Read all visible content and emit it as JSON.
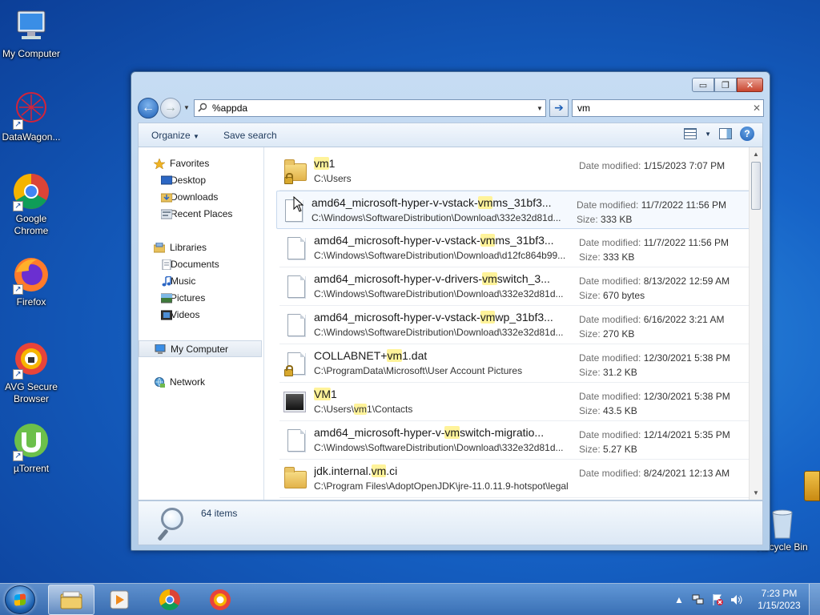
{
  "desktop": {
    "icons": [
      {
        "label": "My Computer"
      },
      {
        "label": "DataWagon..."
      },
      {
        "label": "Google Chrome"
      },
      {
        "label": "Firefox"
      },
      {
        "label": "AVG Secure Browser"
      },
      {
        "label": "µTorrent"
      },
      {
        "label": "Recycle Bin"
      }
    ]
  },
  "window": {
    "caption": {
      "minimize": "▭",
      "maximize": "❐",
      "close": "✕"
    },
    "address": {
      "value": "%appda"
    },
    "search": {
      "value": "vm"
    },
    "toolbar": {
      "organize": "Organize",
      "save_search": "Save search"
    },
    "nav": {
      "favorites": "Favorites",
      "desktop": "Desktop",
      "downloads": "Downloads",
      "recent": "Recent Places",
      "libraries": "Libraries",
      "documents": "Documents",
      "music": "Music",
      "pictures": "Pictures",
      "videos": "Videos",
      "my_computer": "My Computer",
      "network": "Network"
    },
    "labels": {
      "date_modified": "Date modified:",
      "size": "Size:"
    },
    "results": [
      {
        "pre": "",
        "hl": "vm",
        "post": "1",
        "path_pre": "C:\\Users",
        "path_hl": "",
        "path_post": "",
        "date": "1/15/2023 7:07 PM",
        "size": ""
      },
      {
        "pre": "amd64_microsoft-hyper-v-vstack-",
        "hl": "vm",
        "post": "ms_31bf3...",
        "path_pre": "C:\\Windows\\SoftwareDistribution\\Download\\332e32d81d...",
        "path_hl": "",
        "path_post": "",
        "date": "11/7/2022 11:56 PM",
        "size": "333 KB"
      },
      {
        "pre": "amd64_microsoft-hyper-v-vstack-",
        "hl": "vm",
        "post": "ms_31bf3...",
        "path_pre": "C:\\Windows\\SoftwareDistribution\\Download\\d12fc864b99...",
        "path_hl": "",
        "path_post": "",
        "date": "11/7/2022 11:56 PM",
        "size": "333 KB"
      },
      {
        "pre": "amd64_microsoft-hyper-v-drivers-",
        "hl": "vm",
        "post": "switch_3...",
        "path_pre": "C:\\Windows\\SoftwareDistribution\\Download\\332e32d81d...",
        "path_hl": "",
        "path_post": "",
        "date": "8/13/2022 12:59 AM",
        "size": "670 bytes"
      },
      {
        "pre": "amd64_microsoft-hyper-v-vstack-",
        "hl": "vm",
        "post": "wp_31bf3...",
        "path_pre": "C:\\Windows\\SoftwareDistribution\\Download\\332e32d81d...",
        "path_hl": "",
        "path_post": "",
        "date": "6/16/2022 3:21 AM",
        "size": "270 KB"
      },
      {
        "pre": "COLLABNET+",
        "hl": "vm",
        "post": "1.dat",
        "path_pre": "C:\\ProgramData\\Microsoft\\User Account Pictures",
        "path_hl": "",
        "path_post": "",
        "date": "12/30/2021 5:38 PM",
        "size": "31.2 KB"
      },
      {
        "pre": "",
        "hl": "VM",
        "post": "1",
        "path_pre": "C:\\Users\\",
        "path_hl": "vm",
        "path_post": "1\\Contacts",
        "date": "12/30/2021 5:38 PM",
        "size": "43.5 KB"
      },
      {
        "pre": "amd64_microsoft-hyper-v-",
        "hl": "vm",
        "post": "switch-migratio...",
        "path_pre": "C:\\Windows\\SoftwareDistribution\\Download\\332e32d81d...",
        "path_hl": "",
        "path_post": "",
        "date": "12/14/2021 5:35 PM",
        "size": "5.27 KB"
      },
      {
        "pre": "jdk.internal.",
        "hl": "vm",
        "post": ".ci",
        "path_pre": "C:\\Program Files\\AdoptOpenJDK\\jre-11.0.11.9-hotspot\\legal",
        "path_hl": "",
        "path_post": "",
        "date": "8/24/2021 12:13 AM",
        "size": ""
      }
    ],
    "status": {
      "count": "64 items"
    }
  },
  "taskbar": {
    "time": "7:23 PM",
    "date": "1/15/2023"
  },
  "colors": {
    "highlight": "#fff39a",
    "accent": "#1d5fb6"
  }
}
